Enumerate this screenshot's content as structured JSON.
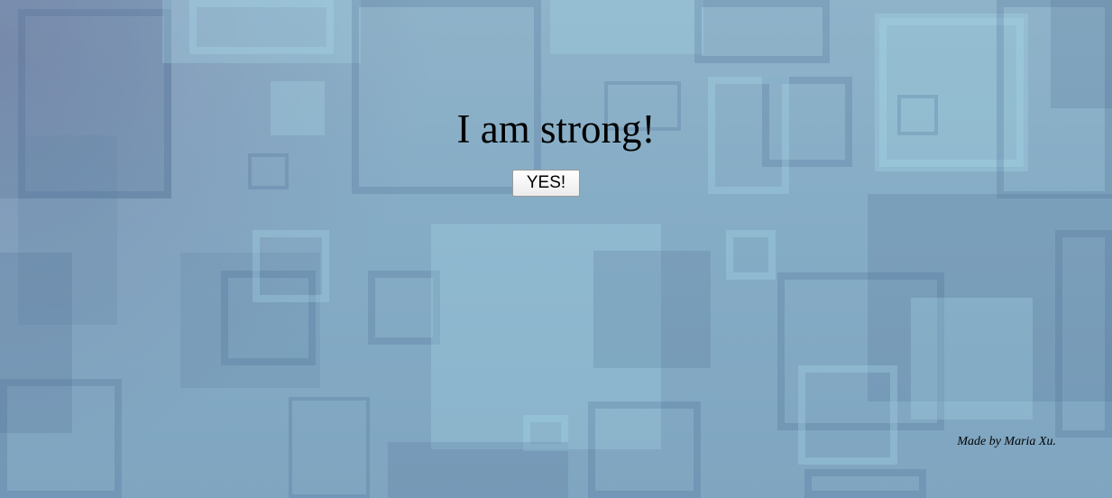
{
  "page": {
    "headline": "I am strong!",
    "button_label": "YES!",
    "credit": "Made by Maria Xu."
  },
  "theme": {
    "background": "#8aafc6",
    "text": "#000000"
  }
}
